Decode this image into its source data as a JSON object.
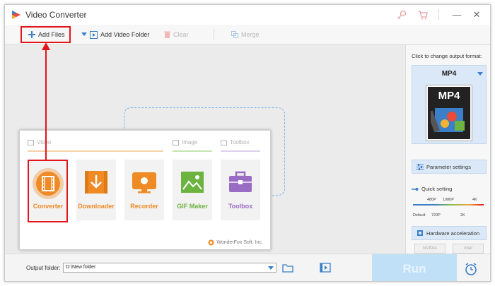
{
  "window": {
    "title": "Video Converter",
    "controls": {
      "minimize": "—",
      "close": "✕"
    }
  },
  "toolbar": {
    "add_files": "Add Files",
    "add_video_folder": "Add Video Folder",
    "clear": "Clear",
    "merge": "Merge"
  },
  "launcher": {
    "sections": {
      "video": "Video",
      "image": "Image",
      "toolbox": "Toolbox"
    },
    "tiles": [
      {
        "label": "Converter",
        "icon": "film-reel-icon",
        "color": "#f08a24"
      },
      {
        "label": "Downloader",
        "icon": "download-arrow-icon",
        "color": "#f08a24"
      },
      {
        "label": "Recorder",
        "icon": "screen-record-icon",
        "color": "#f08a24"
      },
      {
        "label": "GIF Maker",
        "icon": "image-mountain-icon",
        "color": "#6cb33f"
      },
      {
        "label": "Toolbox",
        "icon": "toolbox-icon",
        "color": "#9a6cc4"
      }
    ],
    "brand": "WonderFox Soft, Inc."
  },
  "right_panel": {
    "hint": "Click to change output format:",
    "format": "MP4",
    "format_badge": "MP4",
    "parameter_settings": "Parameter settings",
    "quick_setting": "Quick setting",
    "scale_top": [
      "480P",
      "1080P",
      "4K"
    ],
    "scale_bottom": [
      "Default",
      "720P",
      "2K"
    ],
    "hardware_acceleration": "Hardware acceleration",
    "chips": [
      "NVIDIA",
      "Intel"
    ]
  },
  "bottom": {
    "output_folder_label": "Output folder:",
    "output_folder_value": "D:\\New folder",
    "run": "Run"
  },
  "colors": {
    "accent": "#3a7fc8",
    "highlight": "#e1161b",
    "orange": "#f08a24",
    "green": "#6cb33f",
    "purple": "#9a6cc4"
  }
}
